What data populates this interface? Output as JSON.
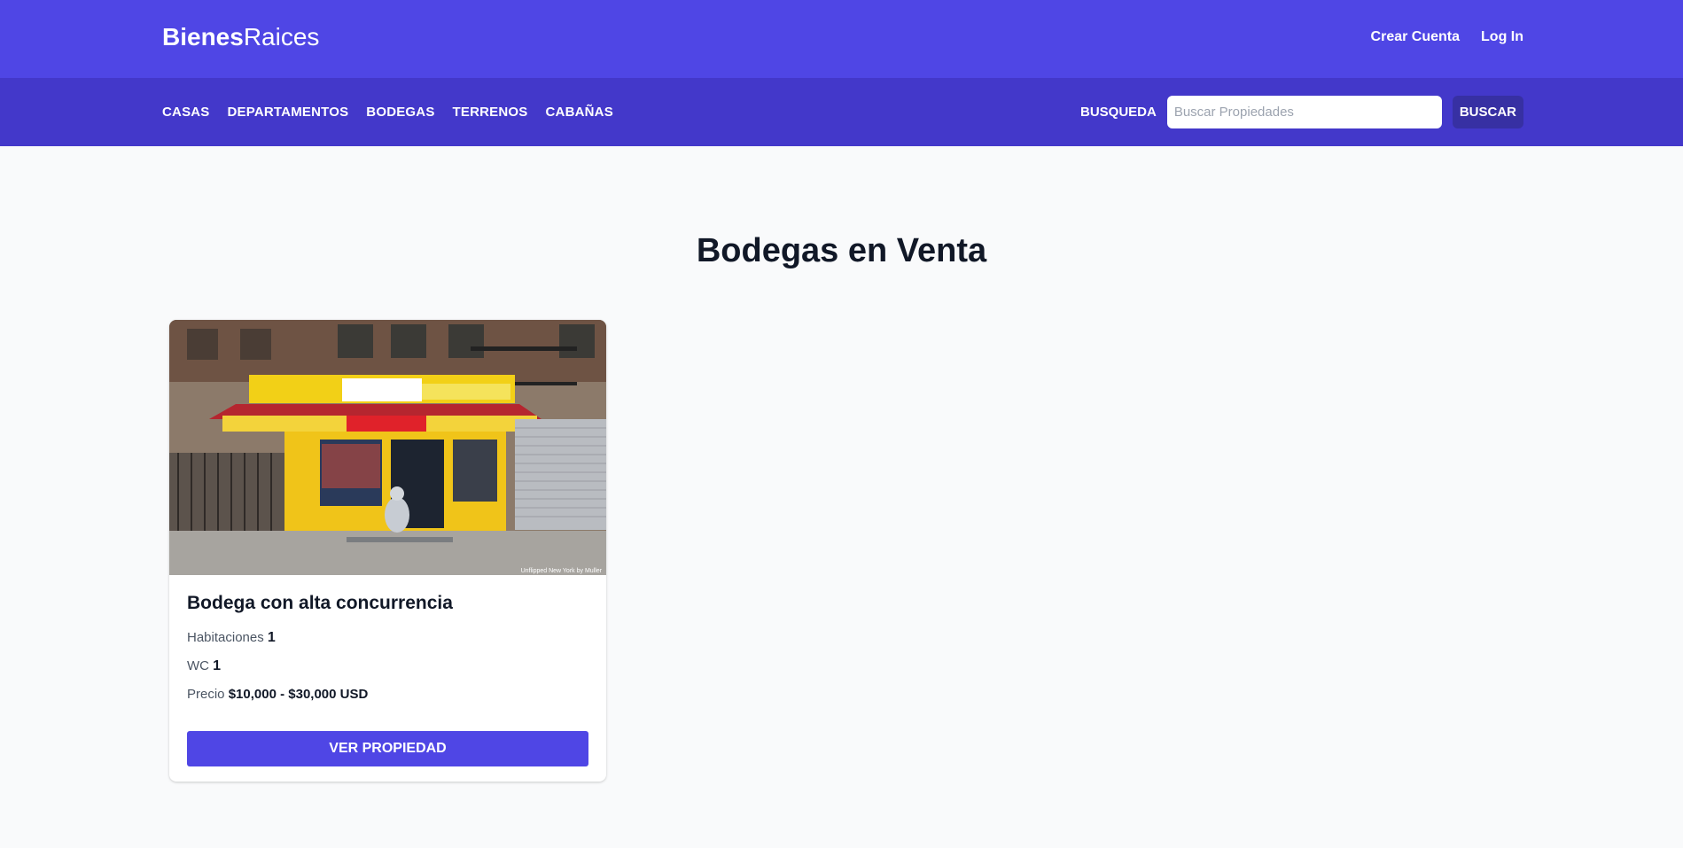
{
  "header": {
    "brand_bold": "Bienes",
    "brand_light": "Raices",
    "links": [
      "Crear Cuenta",
      "Log In"
    ]
  },
  "nav": {
    "categories": [
      "CASAS",
      "DEPARTAMENTOS",
      "BODEGAS",
      "TERRENOS",
      "CABAÑAS"
    ],
    "search_label": "BUSQUEDA",
    "search_placeholder": "Buscar Propiedades",
    "search_button": "BUSCAR"
  },
  "main": {
    "title": "Bodegas en Venta",
    "properties": [
      {
        "title": "Bodega con alta concurrencia",
        "rooms_label": "Habitaciones",
        "rooms": "1",
        "wc_label": "WC",
        "wc": "1",
        "price_label": "Precio",
        "price": "$10,000 - $30,000 USD",
        "button": "VER PROPIEDAD",
        "image_caption": "Unflipped New York by Muller"
      }
    ]
  },
  "colors": {
    "header_bg": "#4f46e5",
    "nav_bg": "#4338ca",
    "search_button_bg": "#3730a3",
    "primary_button": "#4f46e5",
    "page_bg": "#f9fafb"
  }
}
